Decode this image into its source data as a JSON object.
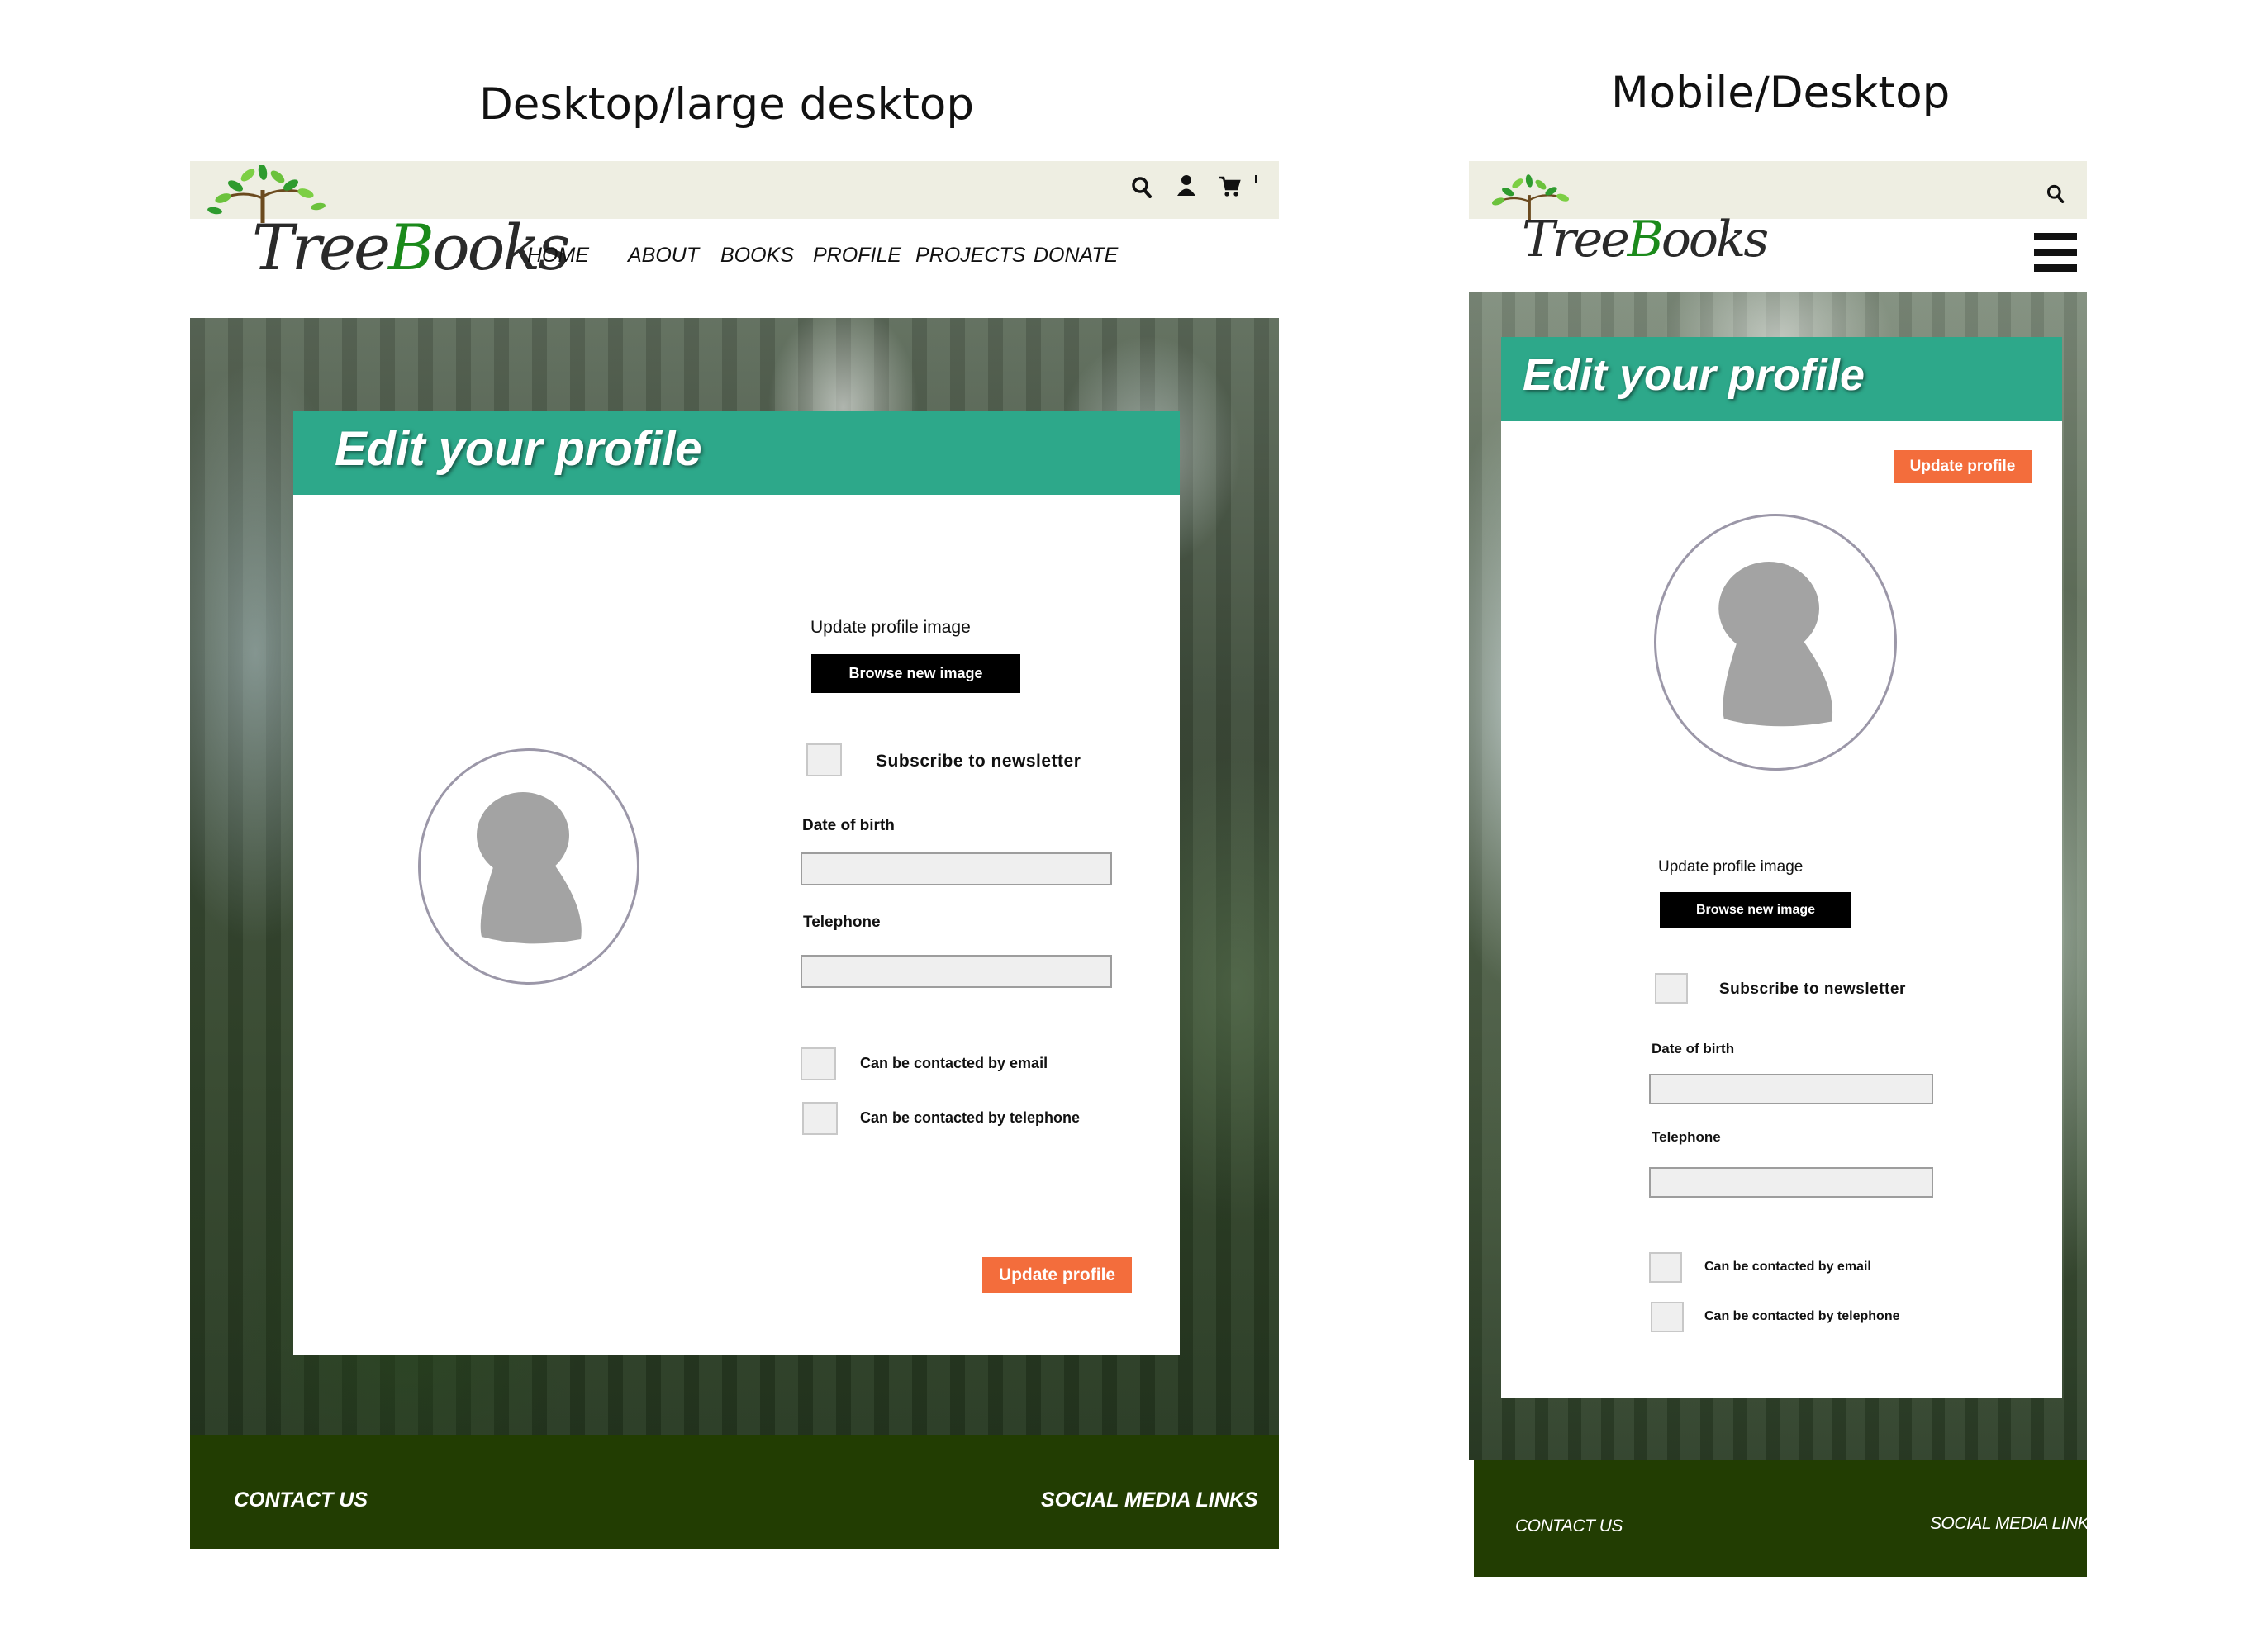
{
  "captions": {
    "desktop": "Desktop/large desktop",
    "mobile": "Mobile/Desktop"
  },
  "logo": {
    "part1": "Tree",
    "part2": "B",
    "part3": "ooks"
  },
  "nav": {
    "items": [
      {
        "label": "HOME"
      },
      {
        "label": "ABOUT"
      },
      {
        "label": "BOOKS"
      },
      {
        "label": "PROFILE"
      },
      {
        "label": "PROJECTS"
      },
      {
        "label": "DONATE"
      }
    ]
  },
  "icons": {
    "search": "search-icon",
    "user": "user-icon",
    "cart": "cart-icon",
    "menu": "hamburger-menu-icon",
    "avatar": "avatar-placeholder-icon"
  },
  "profile": {
    "title": "Edit your profile",
    "update_image_label": "Update profile image",
    "browse_button": "Browse new image",
    "newsletter_label": "Subscribe to newsletter",
    "dob_label": "Date of birth",
    "dob_value": "",
    "telephone_label": "Telephone",
    "telephone_value": "",
    "contact_email_label": "Can be contacted by email",
    "contact_phone_label": "Can be contacted by telephone",
    "update_button": "Update profile"
  },
  "footer": {
    "contact": "CONTACT US",
    "social": "SOCIAL MEDIA LINKS"
  },
  "colors": {
    "top_bar": "#eeeee2",
    "card_header": "#2da88a",
    "update_button": "#f36d3c",
    "browse_button": "#000000",
    "footer": "#223d02",
    "avatar_fill": "#a3a3a3",
    "avatar_ring": "#9b97a8"
  }
}
